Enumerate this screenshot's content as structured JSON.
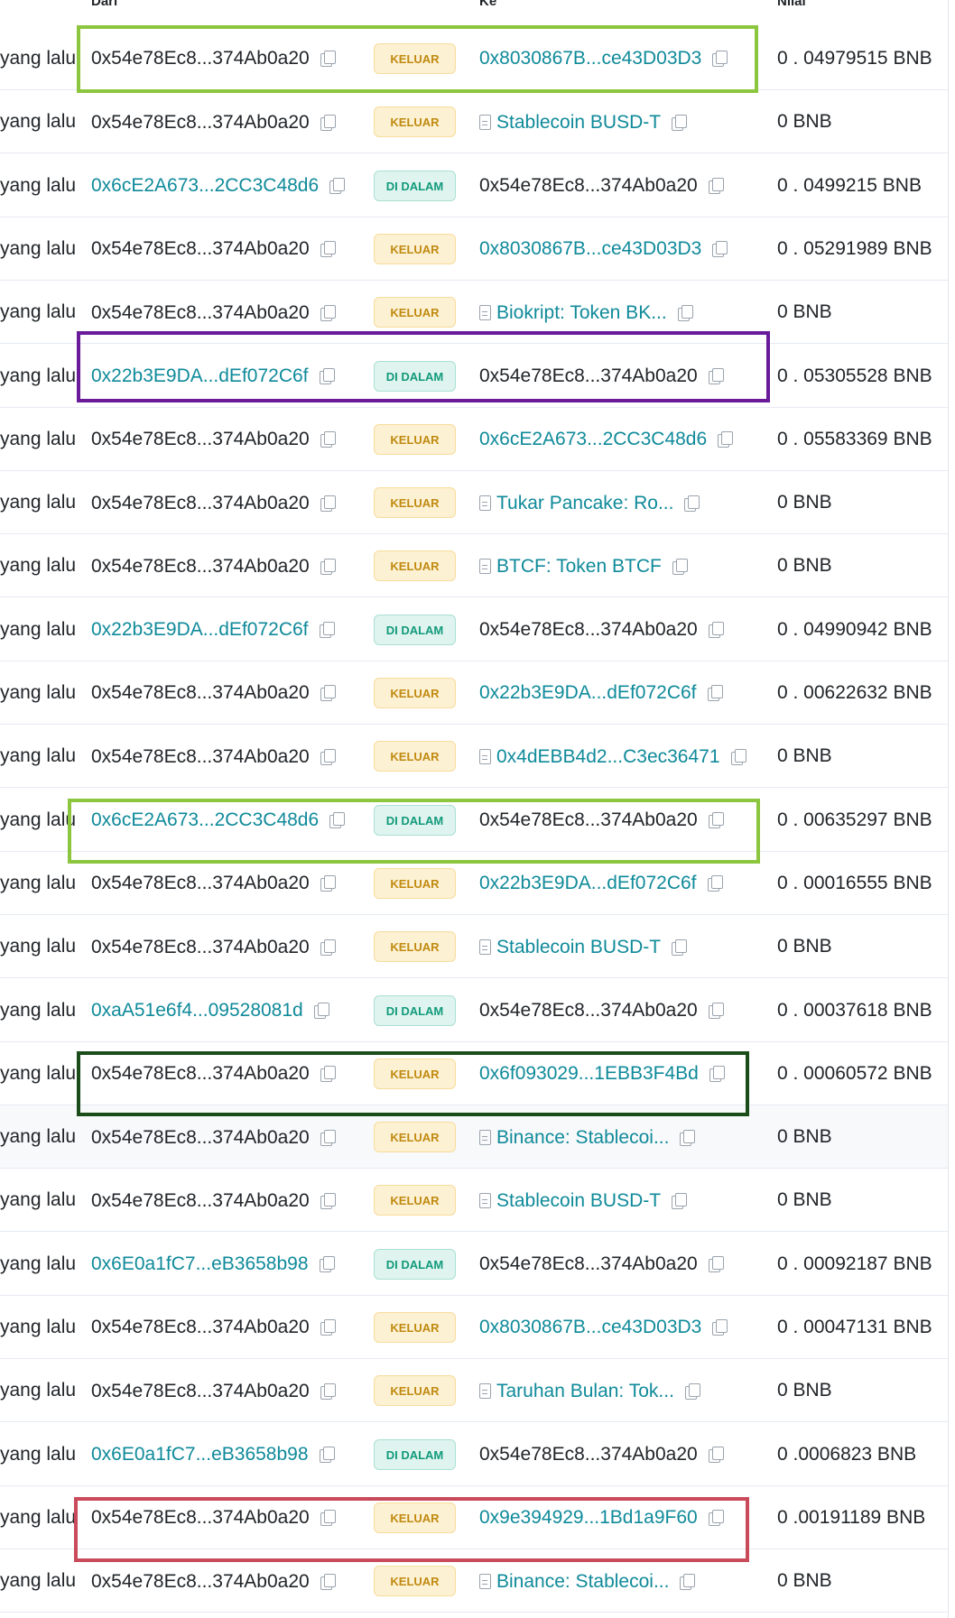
{
  "headers": {
    "dari": "Dari",
    "ke": "Ke",
    "nilai": "Nilai"
  },
  "rows": [
    {
      "age": "yang lalu",
      "from": "0x54e78Ec8...374Ab0a20",
      "from_link": false,
      "dir": "KELUAR",
      "dir_type": "out",
      "to": "0x8030867B...ce43D03D3",
      "to_link": true,
      "to_contract": false,
      "value": "0 . 04979515 BNB"
    },
    {
      "age": "yang lalu",
      "from": "0x54e78Ec8...374Ab0a20",
      "from_link": false,
      "dir": "KELUAR",
      "dir_type": "out",
      "to": "Stablecoin BUSD-T",
      "to_link": true,
      "to_contract": true,
      "value": "0 BNB"
    },
    {
      "age": "yang lalu",
      "from": "0x6cE2A673...2CC3C48d6",
      "from_link": true,
      "dir": "DI DALAM",
      "dir_type": "in",
      "to": "0x54e78Ec8...374Ab0a20",
      "to_link": false,
      "to_contract": false,
      "value": "0 . 0499215 BNB"
    },
    {
      "age": "yang lalu",
      "from": "0x54e78Ec8...374Ab0a20",
      "from_link": false,
      "dir": "KELUAR",
      "dir_type": "out",
      "to": "0x8030867B...ce43D03D3",
      "to_link": true,
      "to_contract": false,
      "value": "0 . 05291989 BNB"
    },
    {
      "age": "yang lalu",
      "from": "0x54e78Ec8...374Ab0a20",
      "from_link": false,
      "dir": "KELUAR",
      "dir_type": "out",
      "to": "Biokript: Token BK...",
      "to_link": true,
      "to_contract": true,
      "value": "0 BNB"
    },
    {
      "age": "yang lalu",
      "from": "0x22b3E9DA...dEf072C6f",
      "from_link": true,
      "dir": "DI DALAM",
      "dir_type": "in",
      "to": "0x54e78Ec8...374Ab0a20",
      "to_link": false,
      "to_contract": false,
      "value": "0 . 05305528 BNB"
    },
    {
      "age": "yang lalu",
      "from": "0x54e78Ec8...374Ab0a20",
      "from_link": false,
      "dir": "KELUAR",
      "dir_type": "out",
      "to": "0x6cE2A673...2CC3C48d6",
      "to_link": true,
      "to_contract": false,
      "value": "0 . 05583369 BNB"
    },
    {
      "age": "yang lalu",
      "from": "0x54e78Ec8...374Ab0a20",
      "from_link": false,
      "dir": "KELUAR",
      "dir_type": "out",
      "to": "Tukar Pancake: Ro...",
      "to_link": true,
      "to_contract": true,
      "value": "0 BNB"
    },
    {
      "age": "yang lalu",
      "from": "0x54e78Ec8...374Ab0a20",
      "from_link": false,
      "dir": "KELUAR",
      "dir_type": "out",
      "to": "BTCF: Token BTCF",
      "to_link": true,
      "to_contract": true,
      "value": "0 BNB"
    },
    {
      "age": "yang lalu",
      "from": "0x22b3E9DA...dEf072C6f",
      "from_link": true,
      "dir": "DI DALAM",
      "dir_type": "in",
      "to": "0x54e78Ec8...374Ab0a20",
      "to_link": false,
      "to_contract": false,
      "value": "0 . 04990942 BNB"
    },
    {
      "age": "yang lalu",
      "from": "0x54e78Ec8...374Ab0a20",
      "from_link": false,
      "dir": "KELUAR",
      "dir_type": "out",
      "to": "0x22b3E9DA...dEf072C6f",
      "to_link": true,
      "to_contract": false,
      "value": "0 . 00622632 BNB"
    },
    {
      "age": "yang lalu",
      "from": "0x54e78Ec8...374Ab0a20",
      "from_link": false,
      "dir": "KELUAR",
      "dir_type": "out",
      "to": "0x4dEBB4d2...C3ec36471",
      "to_link": true,
      "to_contract": true,
      "value": "0 BNB"
    },
    {
      "age": "yang lalu",
      "from": "0x6cE2A673...2CC3C48d6",
      "from_link": true,
      "dir": "DI DALAM",
      "dir_type": "in",
      "to": "0x54e78Ec8...374Ab0a20",
      "to_link": false,
      "to_contract": false,
      "value": "0 . 00635297 BNB"
    },
    {
      "age": "yang lalu",
      "from": "0x54e78Ec8...374Ab0a20",
      "from_link": false,
      "dir": "KELUAR",
      "dir_type": "out",
      "to": "0x22b3E9DA...dEf072C6f",
      "to_link": true,
      "to_contract": false,
      "value": "0 . 00016555 BNB"
    },
    {
      "age": "yang lalu",
      "from": "0x54e78Ec8...374Ab0a20",
      "from_link": false,
      "dir": "KELUAR",
      "dir_type": "out",
      "to": "Stablecoin BUSD-T",
      "to_link": true,
      "to_contract": true,
      "value": "0 BNB"
    },
    {
      "age": "yang lalu",
      "from": "0xaA51e6f4...09528081d",
      "from_link": true,
      "dir": "DI DALAM",
      "dir_type": "in",
      "to": "0x54e78Ec8...374Ab0a20",
      "to_link": false,
      "to_contract": false,
      "value": "0 . 00037618 BNB"
    },
    {
      "age": "yang lalu",
      "from": "0x54e78Ec8...374Ab0a20",
      "from_link": false,
      "dir": "KELUAR",
      "dir_type": "out",
      "to": "0x6f093029...1EBB3F4Bd",
      "to_link": true,
      "to_contract": false,
      "value": "0 . 00060572 BNB"
    },
    {
      "age": "yang lalu",
      "from": "0x54e78Ec8...374Ab0a20",
      "from_link": false,
      "dir": "KELUAR",
      "dir_type": "out",
      "to": "Binance: Stablecoi...",
      "to_link": true,
      "to_contract": true,
      "value": "0 BNB"
    },
    {
      "age": "yang lalu",
      "from": "0x54e78Ec8...374Ab0a20",
      "from_link": false,
      "dir": "KELUAR",
      "dir_type": "out",
      "to": "Stablecoin BUSD-T",
      "to_link": true,
      "to_contract": true,
      "value": "0 BNB"
    },
    {
      "age": "yang lalu",
      "from": "0x6E0a1fC7...eB3658b98",
      "from_link": true,
      "dir": "DI DALAM",
      "dir_type": "in",
      "to": "0x54e78Ec8...374Ab0a20",
      "to_link": false,
      "to_contract": false,
      "value": "0 . 00092187 BNB"
    },
    {
      "age": "yang lalu",
      "from": "0x54e78Ec8...374Ab0a20",
      "from_link": false,
      "dir": "KELUAR",
      "dir_type": "out",
      "to": "0x8030867B...ce43D03D3",
      "to_link": true,
      "to_contract": false,
      "value": "0 . 00047131 BNB"
    },
    {
      "age": "yang lalu",
      "from": "0x54e78Ec8...374Ab0a20",
      "from_link": false,
      "dir": "KELUAR",
      "dir_type": "out",
      "to": "Taruhan Bulan: Tok...",
      "to_link": true,
      "to_contract": true,
      "value": "0 BNB"
    },
    {
      "age": "yang lalu",
      "from": "0x6E0a1fC7...eB3658b98",
      "from_link": true,
      "dir": "DI DALAM",
      "dir_type": "in",
      "to": "0x54e78Ec8...374Ab0a20",
      "to_link": false,
      "to_contract": false,
      "value": "0 .0006823 BNB"
    },
    {
      "age": "yang lalu",
      "from": "0x54e78Ec8...374Ab0a20",
      "from_link": false,
      "dir": "KELUAR",
      "dir_type": "out",
      "to": "0x9e394929...1Bd1a9F60",
      "to_link": true,
      "to_contract": false,
      "value": "0 .00191189 BNB"
    },
    {
      "age": "yang lalu",
      "from": "0x54e78Ec8...374Ab0a20",
      "from_link": false,
      "dir": "KELUAR",
      "dir_type": "out",
      "to": "Binance: Stablecoi...",
      "to_link": true,
      "to_contract": true,
      "value": "0 BNB"
    }
  ],
  "highlights": [
    {
      "row": 0,
      "color": "#8cc63e"
    },
    {
      "row": 5,
      "color": "#6a1b9a"
    },
    {
      "row": 12,
      "color": "#8cc63e"
    },
    {
      "row": 16,
      "color": "#1b4d1b"
    },
    {
      "row": 23,
      "color": "#c94a5a"
    }
  ],
  "colors": {
    "link": "#0f8a9a",
    "out_badge_bg": "#fdf1d4",
    "out_badge_text": "#c08a10",
    "in_badge_bg": "#dff4ef",
    "in_badge_text": "#129a7b"
  }
}
